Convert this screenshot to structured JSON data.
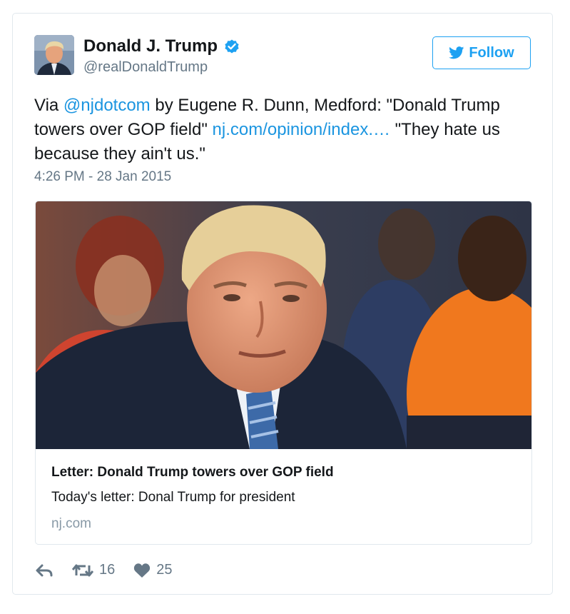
{
  "tweet": {
    "author_name": "Donald J. Trump",
    "author_handle": "@realDonaldTrump",
    "follow_label": "Follow",
    "text_parts": {
      "prefix": "Via ",
      "mention": "@njdotcom",
      "middle": " by Eugene R. Dunn, Medford: \"Donald Trump towers over GOP field\" ",
      "link": "nj.com/opinion/index.…",
      "suffix": " \"They hate us because they ain't us.\""
    },
    "timestamp": "4:26 PM - 28 Jan 2015"
  },
  "card": {
    "title": "Letter: Donald Trump towers over GOP field",
    "description": "Today's letter: Donal Trump for president",
    "domain": "nj.com"
  },
  "actions": {
    "retweet_count": "16",
    "like_count": "25"
  },
  "icons": {
    "verified": "verified-badge-icon",
    "follow": "twitter-bird-icon",
    "reply": "reply-icon",
    "retweet": "retweet-icon",
    "like": "heart-icon"
  },
  "colors": {
    "accent": "#1da1f2",
    "link": "#1b95e0",
    "muted": "#657786"
  }
}
